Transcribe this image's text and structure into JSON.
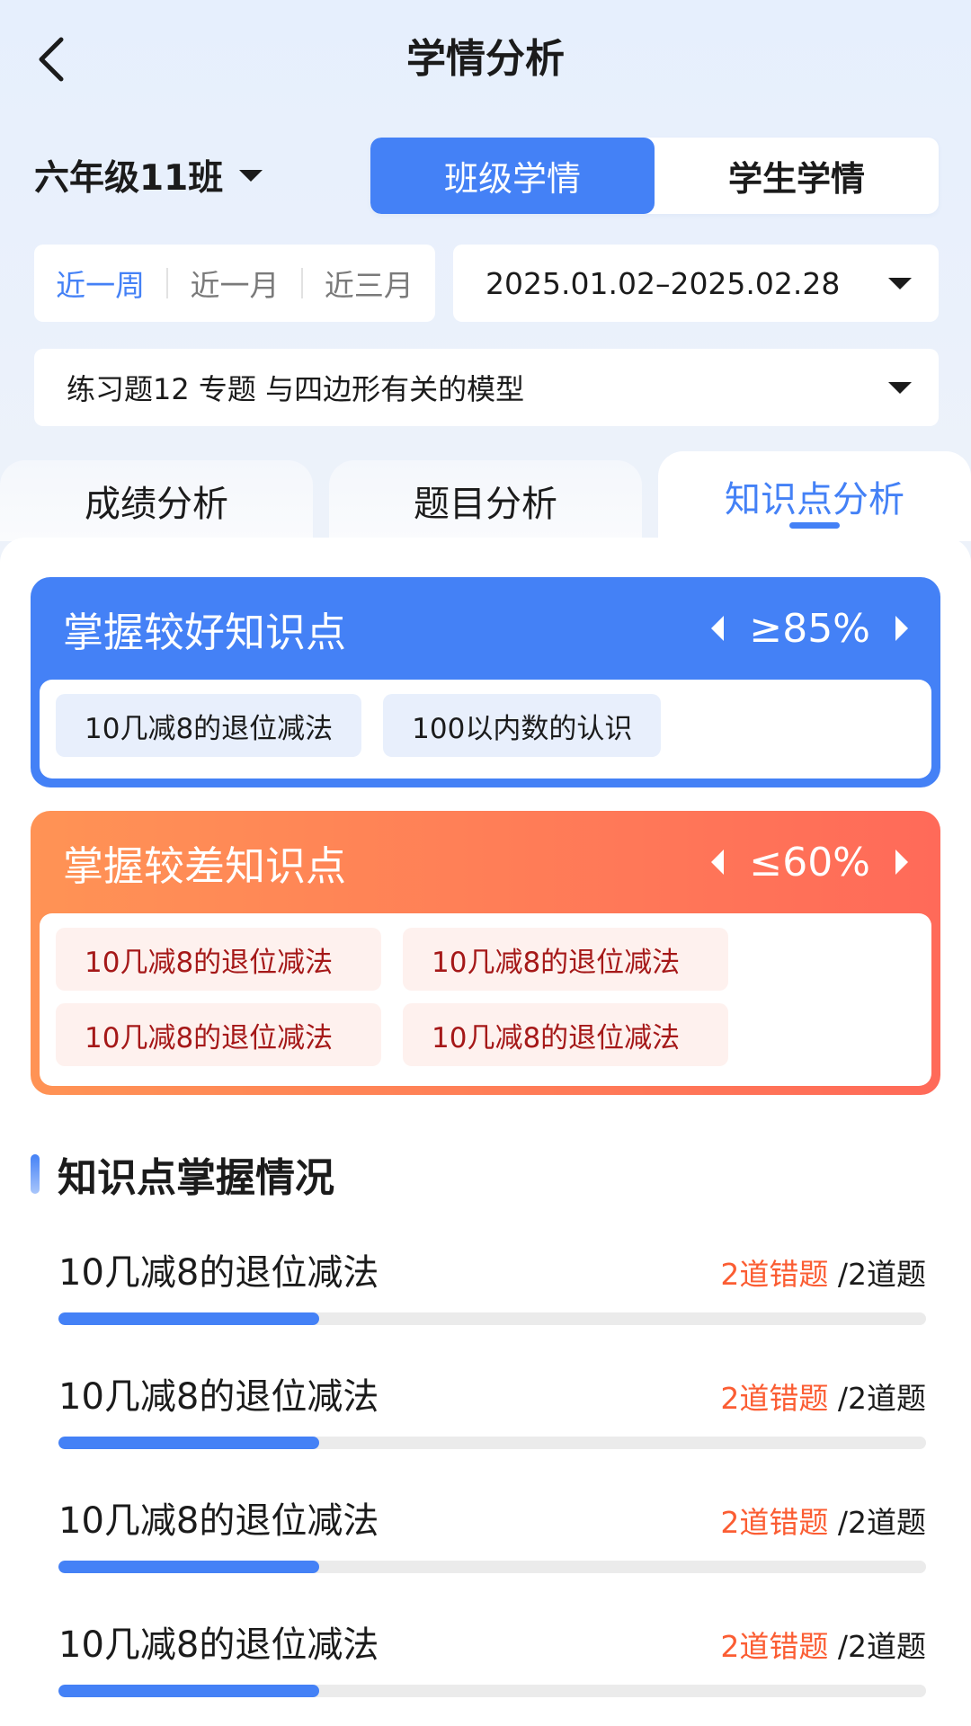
{
  "header": {
    "title": "学情分析"
  },
  "class_selector": {
    "value": "六年级11班"
  },
  "view_toggle": [
    {
      "label": "班级学情",
      "active": true
    },
    {
      "label": "学生学情",
      "active": false
    }
  ],
  "period_options": [
    {
      "label": "近一周",
      "active": true
    },
    {
      "label": "近一月",
      "active": false
    },
    {
      "label": "近三月",
      "active": false
    }
  ],
  "date_range": {
    "value": "2025.01.02–2025.02.28"
  },
  "exercise_selector": {
    "value": "练习题12 专题 与四边形有关的模型"
  },
  "analysis_tabs": [
    {
      "label": "成绩分析",
      "active": false
    },
    {
      "label": "题目分析",
      "active": false
    },
    {
      "label": "知识点分析",
      "active": true
    }
  ],
  "good_card": {
    "title": "掌握较好知识点",
    "threshold": "≥85%",
    "items": [
      "10几减8的退位减法",
      "100以内数的认识"
    ]
  },
  "bad_card": {
    "title": "掌握较差知识点",
    "threshold": "≤60%",
    "items": [
      "10几减8的退位减法",
      "10几减8的退位减法",
      "10几减8的退位减法",
      "10几减8的退位减法"
    ]
  },
  "mastery_section": {
    "title": "知识点掌握情况",
    "rows": [
      {
        "name": "10几减8的退位减法",
        "errors": "2道错题",
        "total": "/2道题",
        "progress": 0.3
      },
      {
        "name": "10几减8的退位减法",
        "errors": "2道错题",
        "total": "/2道题",
        "progress": 0.3
      },
      {
        "name": "10几减8的退位减法",
        "errors": "2道错题",
        "total": "/2道题",
        "progress": 0.3
      },
      {
        "name": "10几减8的退位减法",
        "errors": "2道错题",
        "total": "/2道题",
        "progress": 0.3
      }
    ]
  },
  "colors": {
    "primary": "#4481f6",
    "error": "#fb5d33",
    "bad_gradient_start": "#ff9355",
    "bad_gradient_end": "#ff6a59"
  },
  "icons": {
    "back": "chevron-left-icon",
    "dropdown": "caret-down-icon",
    "prev": "triangle-left-icon",
    "next": "triangle-right-icon"
  }
}
